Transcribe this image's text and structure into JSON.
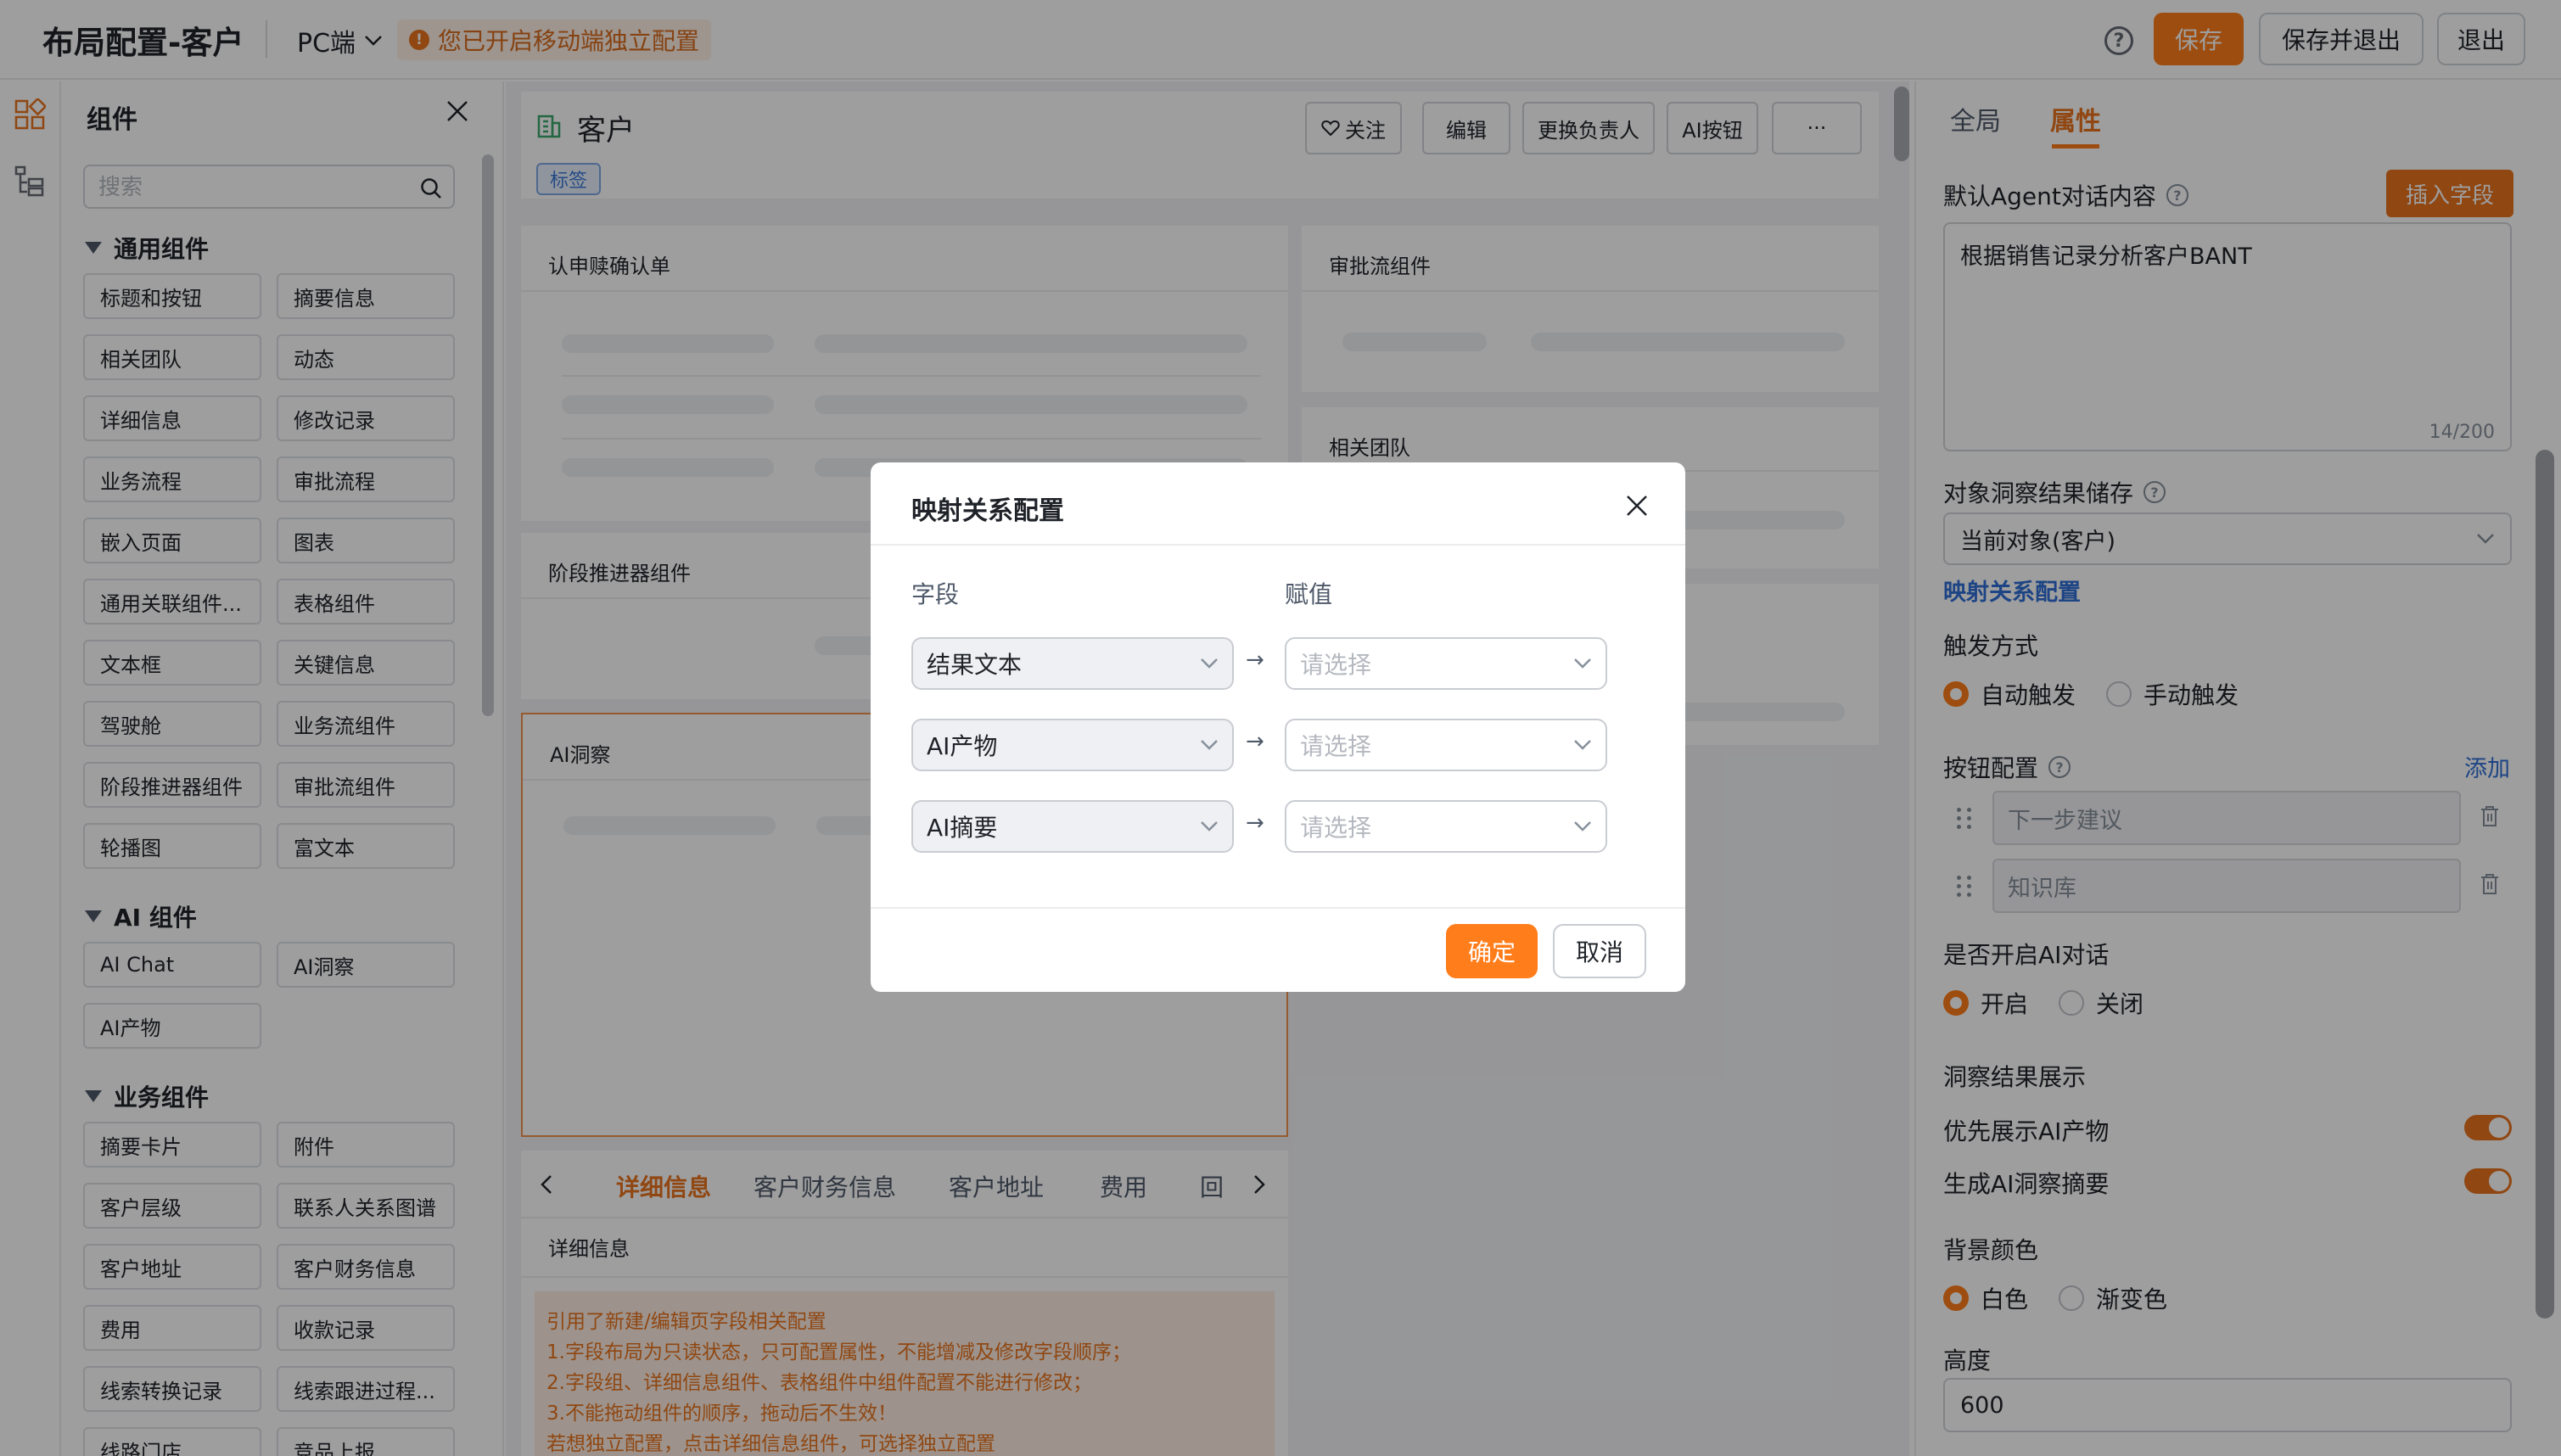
{
  "header": {
    "title": "布局配置-客户",
    "platform": "PC端",
    "mobile_notice": "您已开启移动端独立配置",
    "help_glyph": "?",
    "save": "保存",
    "save_exit": "保存并退出",
    "exit": "退出"
  },
  "components": {
    "title": "组件",
    "search_placeholder": "搜索",
    "sections": [
      {
        "title": "通用组件",
        "items": [
          "标题和按钮",
          "摘要信息",
          "相关团队",
          "动态",
          "详细信息",
          "修改记录",
          "业务流程",
          "审批流程",
          "嵌入页面",
          "图表",
          "通用关联组件...",
          "表格组件",
          "文本框",
          "关键信息",
          "驾驶舱",
          "业务流组件",
          "阶段推进器组件",
          "审批流组件",
          "轮播图",
          "富文本"
        ]
      },
      {
        "title": "AI 组件",
        "items": [
          "AI Chat",
          "AI洞察",
          "AI产物"
        ]
      },
      {
        "title": "业务组件",
        "items": [
          "摘要卡片",
          "附件",
          "客户层级",
          "联系人关系图谱",
          "客户地址",
          "客户财务信息",
          "费用",
          "收款记录",
          "线索转换记录",
          "线索跟进过程...",
          "线路门店",
          "竞品上报"
        ]
      }
    ]
  },
  "canvas": {
    "title": "客户",
    "tag": "标签",
    "actions": {
      "follow": "关注",
      "edit": "编辑",
      "change_owner": "更换负责人",
      "ai_button": "AI按钮",
      "more": "···"
    },
    "cards": {
      "review": "认申赎确认单",
      "approval": "审批流组件",
      "team": "相关团队",
      "stage": "阶段推进器组件",
      "ai_insight": "AI洞察"
    },
    "tabs": [
      "详细信息",
      "客户财务信息",
      "客户地址",
      "费用",
      "回"
    ],
    "detail_title": "详细信息",
    "notice_lines": [
      "引用了新建/编辑页字段相关配置",
      "1.字段布局为只读状态，只可配置属性，不能增减及修改字段顺序；",
      "2.字段组、详细信息组件、表格组件中组件配置不能进行修改；",
      "3.不能拖动组件的顺序，拖动后不生效！",
      "若想独立配置，点击详细信息组件，可选择独立配置"
    ]
  },
  "panel": {
    "tab_global": "全局",
    "tab_props": "属性",
    "agent_label": "默认Agent对话内容",
    "insert_field": "插入字段",
    "agent_content": "根据销售记录分析客户BANT",
    "agent_count": "14/200",
    "storage_label": "对象洞察结果储存",
    "storage_value": "当前对象(客户)",
    "mapping_link": "映射关系配置",
    "trigger_label": "触发方式",
    "trigger_auto": "自动触发",
    "trigger_manual": "手动触发",
    "trigger_selected": "自动触发",
    "buttons_label": "按钮配置",
    "add": "添加",
    "buttons": [
      "下一步建议",
      "知识库"
    ],
    "ai_chat_label": "是否开启AI对话",
    "on": "开启",
    "off": "关闭",
    "ai_chat_selected": "开启",
    "insight_label": "洞察结果展示",
    "prefer_ai": "优先展示AI产物",
    "prefer_ai_on": true,
    "gen_summary": "生成AI洞察摘要",
    "gen_summary_on": true,
    "bg_label": "背景颜色",
    "bg_white": "白色",
    "bg_gradient": "渐变色",
    "bg_selected": "白色",
    "height_label": "高度",
    "height_value": "600"
  },
  "modal": {
    "title": "映射关系配置",
    "col_field": "字段",
    "col_value": "赋值",
    "rows": [
      {
        "field": "结果文本",
        "value_placeholder": "请选择"
      },
      {
        "field": "AI产物",
        "value_placeholder": "请选择"
      },
      {
        "field": "AI摘要",
        "value_placeholder": "请选择"
      }
    ],
    "arrow": "→",
    "confirm": "确定",
    "cancel": "取消"
  },
  "colors": {
    "accent": "#ff7d1a",
    "link": "#2f6fd6",
    "notice_text": "#e8731e",
    "notice_bg": "#fdeee2",
    "overlay": "rgba(0,0,0,0.38)"
  },
  "icons": [
    "chevron-down-icon",
    "warning-icon",
    "help-icon",
    "components-icon",
    "tree-icon",
    "close-icon",
    "search-icon",
    "caret-down-icon",
    "building-icon",
    "heart-icon",
    "question-icon",
    "drag-handle-icon",
    "trash-icon",
    "chevron-left-icon",
    "chevron-right-icon",
    "arrow-right-icon"
  ]
}
